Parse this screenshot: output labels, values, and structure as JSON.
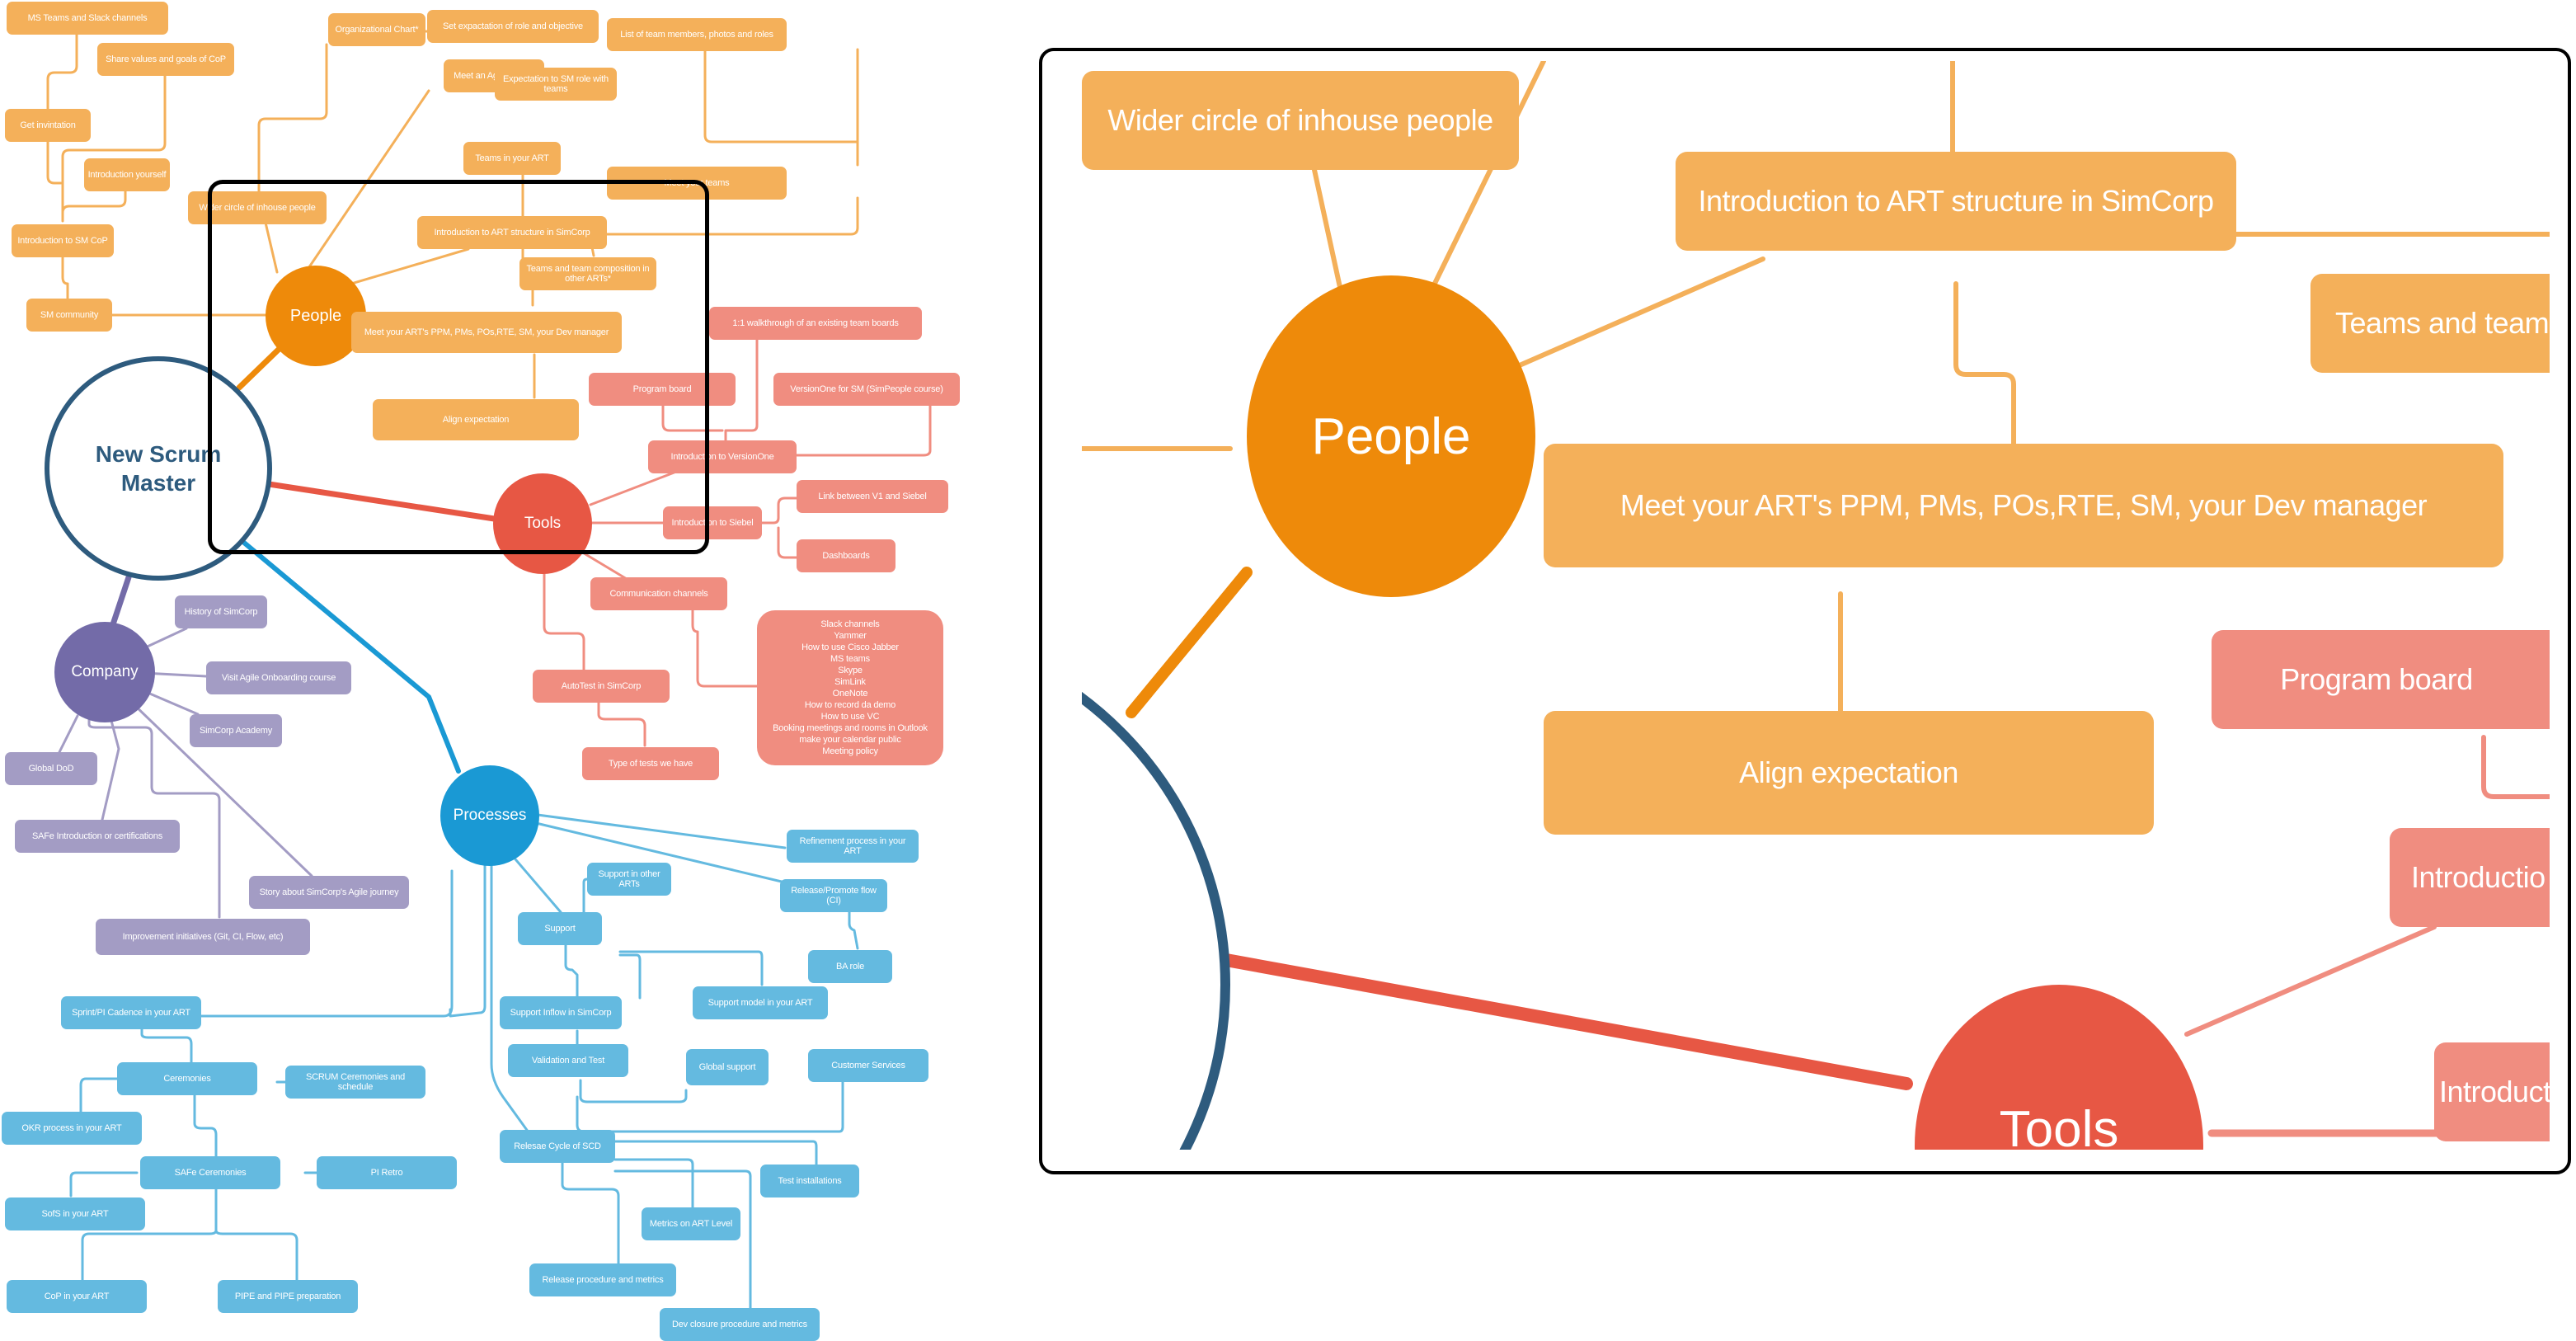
{
  "root": {
    "label_line1": "New Scrum",
    "label_line2": "Master",
    "color": "#2e5b7e"
  },
  "branches": {
    "people": {
      "label": "People",
      "color": "#ee8a0a",
      "node_color": "#f4b05a"
    },
    "tools": {
      "label": "Tools",
      "color": "#e75744",
      "node_color": "#f08d80"
    },
    "company": {
      "label": "Company",
      "color": "#736ba8",
      "node_color": "#a39cc4"
    },
    "process": {
      "label": "Processes",
      "color": "#1a99d4",
      "node_color": "#64bae0"
    }
  },
  "people_nodes": {
    "ms_teams": "MS Teams and Slack channels",
    "share_values": "Share values and goals of CoP",
    "get_invitation": "Get invintation",
    "introduction_yourself": "Introduction yourself",
    "intro_sm_cop": "Introduction to SM CoP",
    "sm_community": "SM community",
    "org_chart": "Organizational Chart*",
    "set_expectation": "Set expactation of role and objective",
    "meet_agile_coach": "Meet an Agile Coach",
    "wider_circle": "Wider circle of inhouse people",
    "teams_in_art": "Teams in your ART",
    "intro_art_structure": "Introduction to ART structure in SimCorp",
    "list_team_members": "List of team members, photos and roles",
    "expectation_sm_role": "Expectation to SM role with teams",
    "meet_your_teams": "Meet your teams",
    "teams_other_arts": "Teams and team composition in other ARTs*",
    "meet_art_ppm": "Meet your ART's PPM, PMs, POs,RTE, SM, your Dev manager",
    "align_expectation": "Align expectation"
  },
  "tools_nodes": {
    "walkthrough": "1:1 walkthrough of an existing team boards",
    "program_board": "Program board",
    "versionone_sm": "VersionOne for SM (SimPeople course)",
    "intro_versionone": "Introduction to VersionOne",
    "intro_siebel": "Introduction to Siebel",
    "link_v1_siebel": "Link between V1 and Siebel",
    "dashboards": "Dashboards",
    "communication_channels": "Communication channels",
    "autotest": "AutoTest in SimCorp",
    "type_of_tests": "Type of tests we have",
    "channels_list": [
      "Slack channels",
      "Yammer",
      "How to use Cisco Jabber",
      "MS teams",
      "Skype",
      "SimLink",
      "OneNote",
      "How to record da demo",
      "How to use VC",
      "Booking meetings and rooms in Outlook",
      "make your calendar public",
      "Meeting policy"
    ]
  },
  "company_nodes": {
    "history": "History of SimCorp",
    "visit_onboarding": "Visit Agile Onboarding course",
    "academy": "SimCorp Academy",
    "global_dod": "Global DoD",
    "safe_intro": "SAFe Introduction or certifications",
    "story_journey": "Story about SimCorp's Agile journey",
    "improvement": "Improvement initiatives (Git, CI, Flow, etc)"
  },
  "process_nodes": {
    "refinement": "Refinement process in your ART",
    "support_other_arts": "Support in other ARTs",
    "release_promote": "Release/Promote flow (CI)",
    "support": "Support",
    "ba_role": "BA role",
    "support_inflow": "Support Inflow in SimCorp",
    "support_model": "Support model in your ART",
    "validation_test": "Validation and Test",
    "global_support": "Global support",
    "customer_services": "Customer Services",
    "sprint_cadence": "Sprint/PI Cadence in your ART",
    "ceremonies": "Ceremonies",
    "scrum_ceremonies": "SCRUM Ceremonies and schedule",
    "okr_process": "OKR process in your ART",
    "safe_ceremonies": "SAFe Ceremonies",
    "pi_retro": "PI Retro",
    "sofs": "SofS in your ART",
    "release_cycle": "Relesae Cycle of SCD",
    "test_installations": "Test installations",
    "metrics_art": "Metrics on ART Level",
    "release_procedure": "Release procedure and metrics",
    "cop_art": "CoP in your ART",
    "pipe_prep": "PIPE and PIPE preparation",
    "dev_closure": "Dev closure procedure and metrics"
  },
  "inset": {
    "wider_circle": "Wider circle of inhouse people",
    "intro_art_structure": "Introduction to ART structure in SimCorp",
    "teams_other_arts_partial": "Teams and team",
    "people": "People",
    "meet_art_ppm": "Meet your ART's PPM, PMs, POs,RTE, SM, your Dev manager",
    "program_board": "Program board",
    "align_expectation": "Align expectation",
    "intro_partial_1": "Introductio",
    "intro_partial_2": "Introductio",
    "tools": "Tools"
  }
}
